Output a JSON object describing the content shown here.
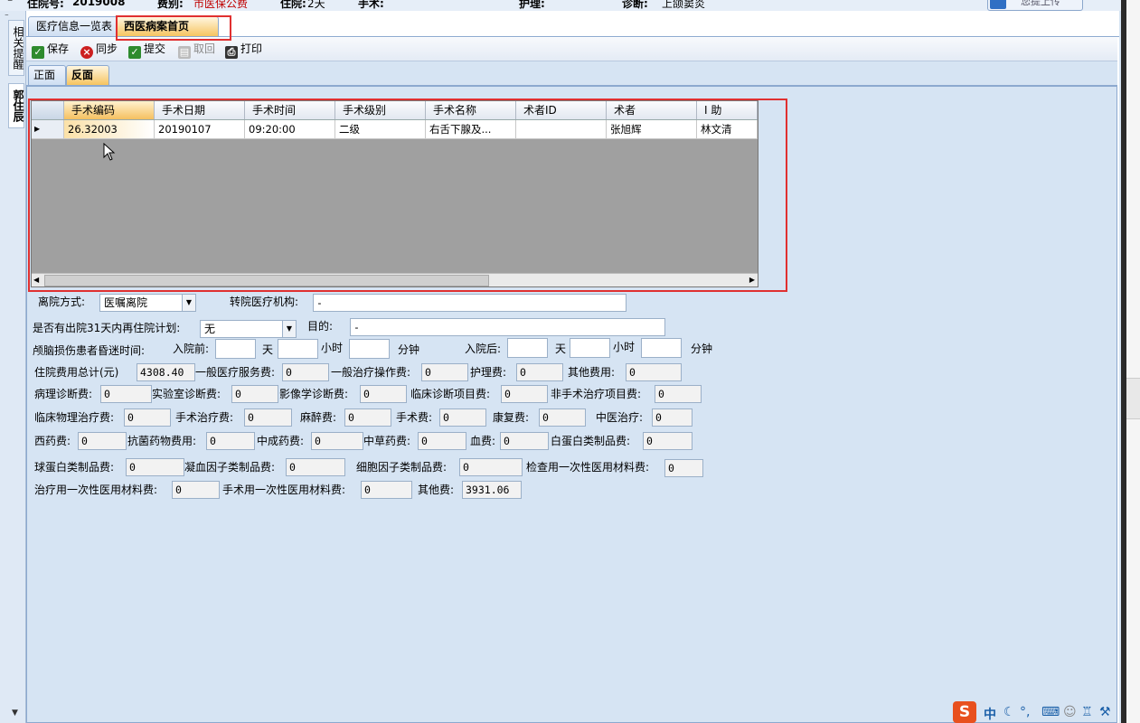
{
  "topbar": {
    "admission_no_label": "住院号:",
    "admission_no_value": "2019008",
    "fee_type_label": "费别:",
    "fee_type_value": "市医保公费",
    "stay_label": "住院:",
    "stay_value": "2天",
    "surgery_label": "手术:",
    "nursing_label": "护理:",
    "diagnosis_label": "诊断:",
    "diagnosis_value": "上颌窦炎",
    "upload_button": "您提上传"
  },
  "left_panel": {
    "tab1": "相关提醒",
    "tab2": "郭住辰"
  },
  "outer_tabs": [
    "医疗信息一览表",
    "西医病案首页"
  ],
  "toolbar": {
    "save": "保存",
    "sync": "同步",
    "submit": "提交",
    "recall": "取回",
    "print": "打印"
  },
  "inner_tabs": [
    "正面",
    "反面"
  ],
  "grid": {
    "columns": [
      "手术编码",
      "手术日期",
      "手术时间",
      "手术级别",
      "手术名称",
      "术者ID",
      "术者",
      "I 助"
    ],
    "rows": [
      [
        "26.32003",
        "20190107",
        "09:20:00",
        "二级",
        "右舌下腺及...",
        "",
        "张旭辉",
        "林文清"
      ]
    ]
  },
  "form": {
    "discharge_method_label": "离院方式:",
    "discharge_method_value": "医嘱离院",
    "transfer_org_label": "转院医疗机构:",
    "transfer_org_value": "-",
    "readmit_label": "是否有出院31天内再住院计划:",
    "readmit_value": "无",
    "purpose_label": "目的:",
    "purpose_value": "-",
    "coma_label": "颅脑损伤患者昏迷时间:",
    "before_admit_label": "入院前:",
    "after_admit_label": "入院后:",
    "day_unit": "天",
    "hour_unit": "小时",
    "minute_unit": "分钟",
    "total_cost_label": "住院费用总计(元)",
    "total_cost_value": "4308.40",
    "general_service_label": "一般医疗服务费:",
    "general_service_value": "0",
    "general_treatment_label": "一般治疗操作费:",
    "general_treatment_value": "0",
    "nursing_fee_label": "护理费:",
    "nursing_fee_value": "0",
    "other_fee_label": "其他费用:",
    "other_fee_value": "0",
    "pathology_label": "病理诊断费:",
    "pathology_value": "0",
    "lab_label": "实验室诊断费:",
    "lab_value": "0",
    "imaging_label": "影像学诊断费:",
    "imaging_value": "0",
    "clinical_diag_label": "临床诊断项目费:",
    "clinical_diag_value": "0",
    "nonsurgical_label": "非手术治疗项目费:",
    "nonsurgical_value": "0",
    "physio_label": "临床物理治疗费:",
    "physio_value": "0",
    "surgical_treat_label": "手术治疗费:",
    "surgical_treat_value": "0",
    "anesthesia_label": "麻醉费:",
    "anesthesia_value": "0",
    "surgery_fee_label": "手术费:",
    "surgery_fee_value": "0",
    "rehab_label": "康复费:",
    "rehab_value": "0",
    "tcm_label": "中医治疗:",
    "tcm_value": "0",
    "western_med_label": "西药费:",
    "western_med_value": "0",
    "antibiotic_label": "抗菌药物费用:",
    "antibiotic_value": "0",
    "patent_med_label": "中成药费:",
    "patent_med_value": "0",
    "herbal_label": "中草药费:",
    "herbal_value": "0",
    "blood_label": "血费:",
    "blood_value": "0",
    "albumin_label": "白蛋白类制品费:",
    "albumin_value": "0",
    "globulin_label": "球蛋白类制品费:",
    "globulin_value": "0",
    "coag_label": "凝血因子类制品费:",
    "coag_value": "0",
    "cytokine_label": "细胞因子类制品费:",
    "cytokine_value": "0",
    "exam_material_label": "检查用一次性医用材料费:",
    "exam_material_value": "0",
    "treat_material_label": "治疗用一次性医用材料费:",
    "treat_material_value": "0",
    "surg_material_label": "手术用一次性医用材料费:",
    "surg_material_value": "0",
    "other2_label": "其他费:",
    "other2_value": "3931.06"
  },
  "ime": {
    "logo": "S",
    "mode": "中",
    "punct": "°,"
  },
  "colors": {
    "highlight": "#e03030",
    "active_tab": "#f6c460",
    "background": "#d6e4f3",
    "fee_type": "#c00000"
  }
}
